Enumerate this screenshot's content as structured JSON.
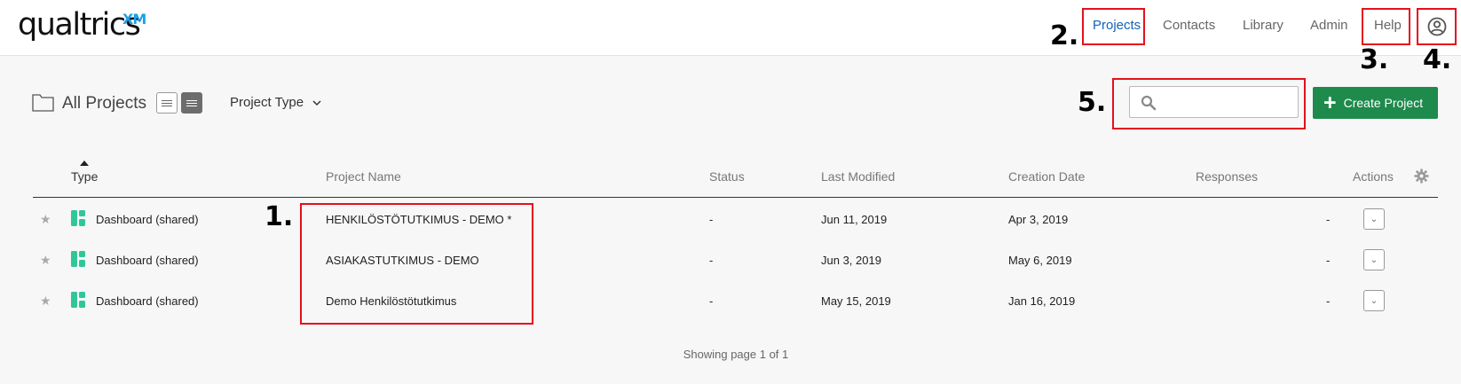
{
  "brand": {
    "logo_text": "qualtrics",
    "logo_superscript": "XM"
  },
  "nav": {
    "items": [
      {
        "label": "Projects",
        "active": true
      },
      {
        "label": "Contacts",
        "active": false
      },
      {
        "label": "Library",
        "active": false
      },
      {
        "label": "Admin",
        "active": false
      },
      {
        "label": "Help",
        "active": false
      }
    ],
    "user_icon": "user-circle-icon"
  },
  "annotations": [
    "1.",
    "2.",
    "3.",
    "4.",
    "5."
  ],
  "toolbar": {
    "title": "All Projects",
    "project_type_label": "Project Type",
    "search_placeholder": "",
    "create_label": "Create Project"
  },
  "table": {
    "columns": [
      "Type",
      "Project Name",
      "Status",
      "Last Modified",
      "Creation Date",
      "Responses",
      "Actions"
    ],
    "rows": [
      {
        "type": "Dashboard (shared)",
        "name": "HENKILÖSTÖTUTKIMUS - DEMO *",
        "status": "-",
        "last_modified": "Jun 11, 2019",
        "created": "Apr 3, 2019",
        "responses": "-"
      },
      {
        "type": "Dashboard (shared)",
        "name": "ASIAKASTUTKIMUS - DEMO",
        "status": "-",
        "last_modified": "Jun 3, 2019",
        "created": "May 6, 2019",
        "responses": "-"
      },
      {
        "type": "Dashboard (shared)",
        "name": "Demo Henkilöstötutkimus",
        "status": "-",
        "last_modified": "May 15, 2019",
        "created": "Jan 16, 2019",
        "responses": "-"
      }
    ]
  },
  "pager": {
    "text": "Showing page 1 of 1"
  },
  "colors": {
    "accent": "#1463b8",
    "create_button": "#1e8a4c",
    "annotation_red": "#e4101c",
    "dashboard_icon": "#2fc79a"
  }
}
